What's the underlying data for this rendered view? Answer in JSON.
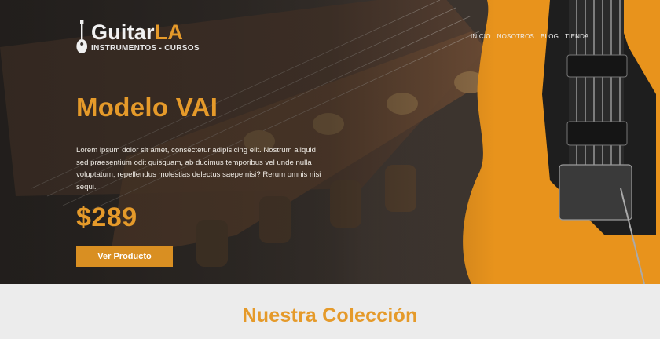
{
  "header": {
    "logo": {
      "main_a": "Guitar",
      "main_b": "LA",
      "sub": "INSTRUMENTOS - CURSOS"
    },
    "nav": [
      "Inicio",
      "Nosotros",
      "Blog",
      "Tienda"
    ]
  },
  "hero": {
    "title": "Modelo VAI",
    "description": "Lorem ipsum dolor sit amet, consectetur adipisicing elit. Nostrum aliquid sed praesentium odit quisquam, ab ducimus temporibus vel unde nulla voluptatum, repellendus molestias delectus saepe nisi? Rerum omnis nisi sequi.",
    "price": "$289",
    "button_label": "Ver Producto"
  },
  "collection": {
    "title": "Nuestra Colección"
  },
  "colors": {
    "accent": "#e59a2a",
    "button": "#d98f22",
    "guitar_body": "#e8931c"
  }
}
